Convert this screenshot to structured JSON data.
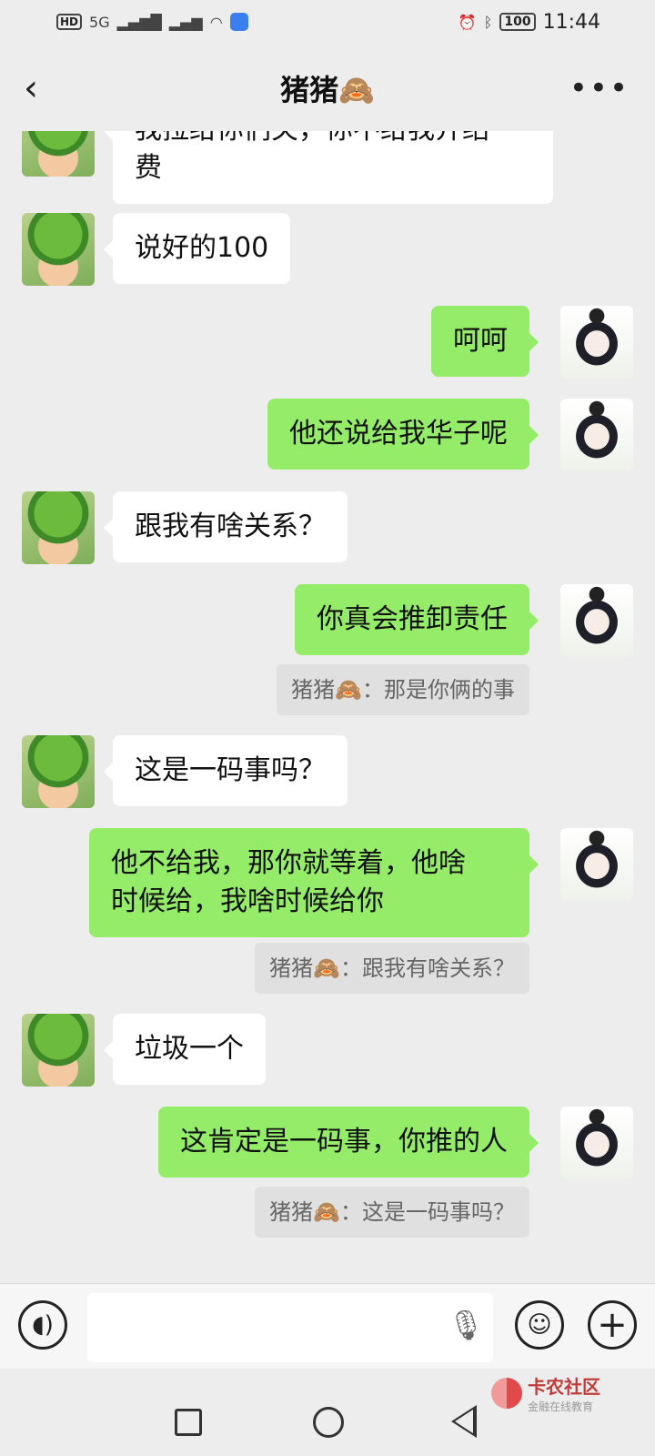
{
  "status_bar": {
    "left_icons": [
      "HD",
      "5G"
    ],
    "battery": "100",
    "time": "11:44"
  },
  "header": {
    "back_icon": "chevron-left-icon",
    "title": "猪猪🙈",
    "more_icon": "more-dots-icon"
  },
  "messages": [
    {
      "side": "left",
      "text": "我拉给你们关，你不给我介绍\n费"
    },
    {
      "side": "left",
      "text": "说好的100"
    },
    {
      "side": "right",
      "text": "呵呵"
    },
    {
      "side": "right",
      "text": "他还说给我华子呢"
    },
    {
      "side": "left",
      "text": "跟我有啥关系？"
    },
    {
      "side": "right",
      "text": "你真会推卸责任",
      "quote": "猪猪🙈：那是你俩的事"
    },
    {
      "side": "left",
      "text": "这是一码事吗？"
    },
    {
      "side": "right",
      "text": "他不给我，那你就等着，他啥\n时候给，我啥时候给你",
      "quote": "猪猪🙈：跟我有啥关系？"
    },
    {
      "side": "left",
      "text": "垃圾一个"
    },
    {
      "side": "right",
      "text": "这肯定是一码事，你推的人",
      "quote": "猪猪🙈：这是一码事吗？"
    }
  ],
  "input_bar": {
    "voice_icon": "voice-icon",
    "placeholder": "",
    "mic_icon": "mic-icon",
    "emoji_icon": "emoji-icon",
    "plus_icon": "plus-icon"
  },
  "watermark": {
    "title": "卡农社区",
    "subtitle": "金融在线教育"
  }
}
